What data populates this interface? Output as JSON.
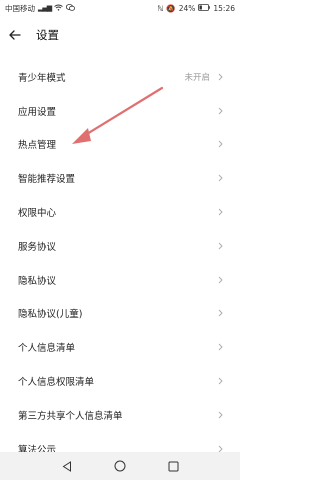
{
  "status_bar": {
    "carrier": "中国移动",
    "signal": "4G",
    "battery": "24%",
    "time": "15:26"
  },
  "header": {
    "title": "设置",
    "back_icon": "arrow-left-icon"
  },
  "items": [
    {
      "label": "青少年模式",
      "value": "未开启"
    },
    {
      "label": "应用设置"
    },
    {
      "label": "热点管理"
    },
    {
      "label": "智能推荐设置"
    },
    {
      "label": "权限中心"
    },
    {
      "label": "服务协议"
    },
    {
      "label": "隐私协议"
    },
    {
      "label": "隐私协议(儿童)"
    },
    {
      "label": "个人信息清单"
    },
    {
      "label": "个人信息权限清单"
    },
    {
      "label": "第三方共享个人信息清单"
    },
    {
      "label": "算法公示"
    }
  ],
  "colors": {
    "annotation_arrow": "#e07070",
    "nav_bar_bg": "#f2f2f2"
  }
}
